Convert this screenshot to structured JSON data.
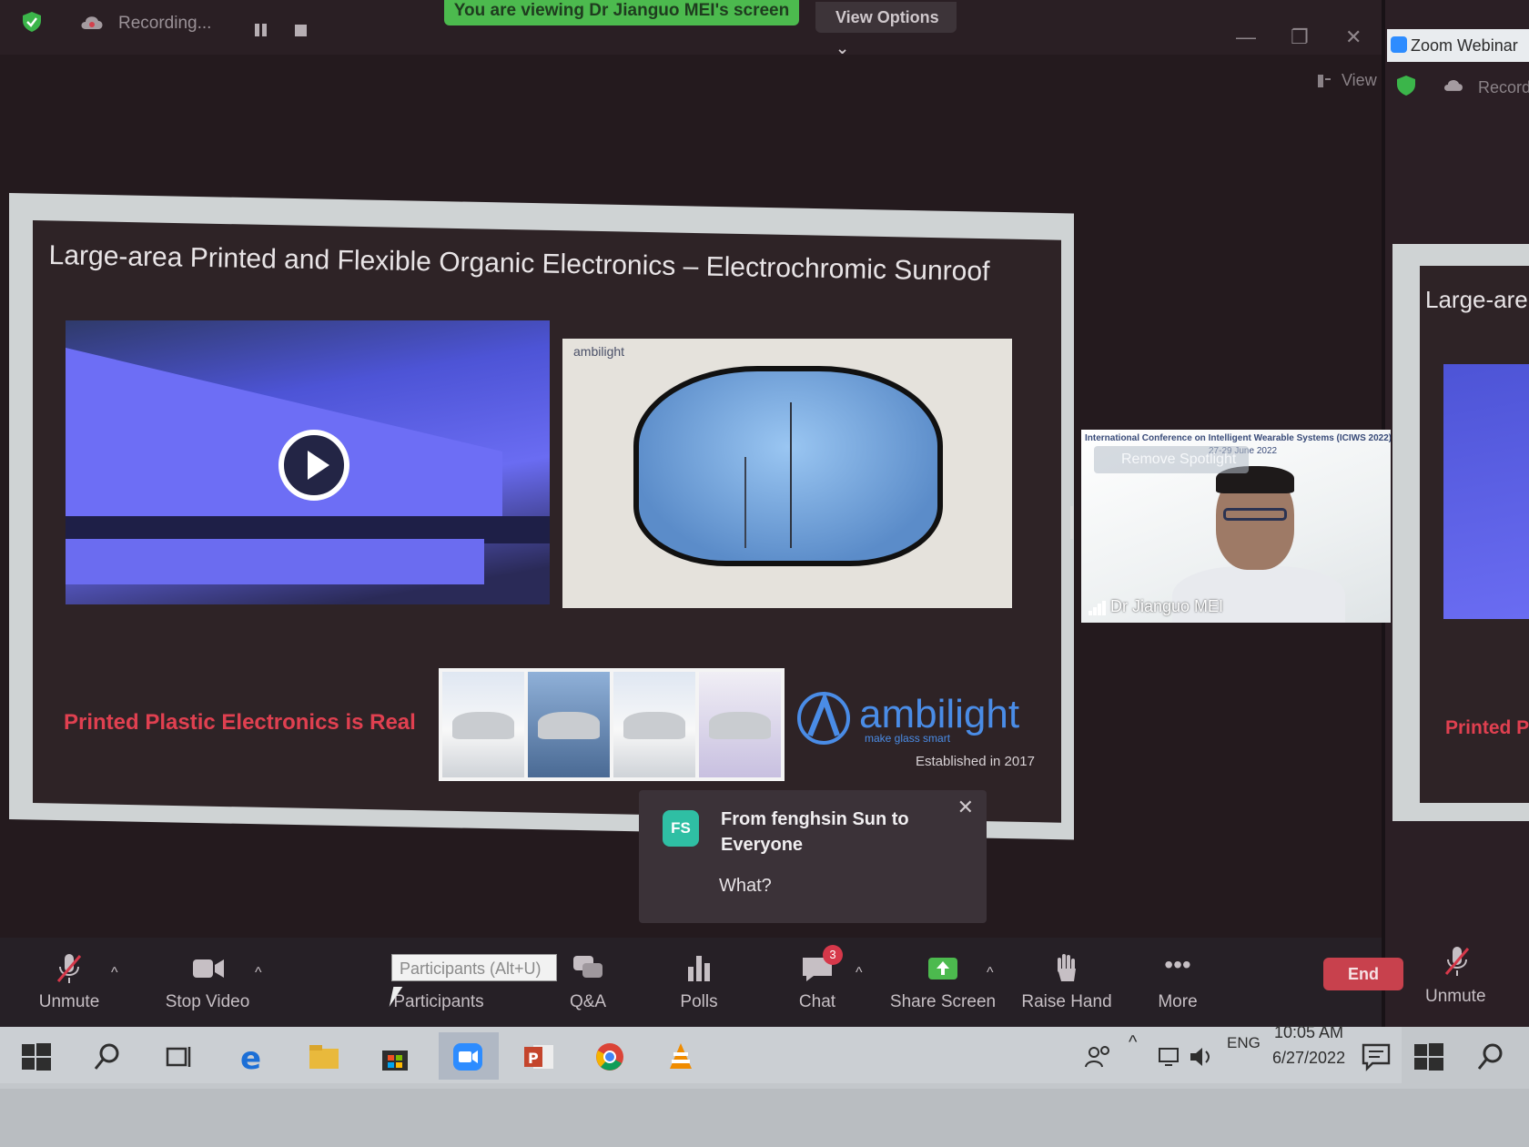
{
  "topbar": {
    "recording_label": "Recording...",
    "viewing_banner": "You are viewing Dr Jianguo MEI's screen",
    "view_options_label": "View Options",
    "view_label": "View"
  },
  "window2": {
    "title": "Zoom Webinar",
    "recording_label": "Recordi",
    "slide_title_partial": "Large-are",
    "red_tag_partial": "Printed P",
    "unmute_label": "Unmute"
  },
  "slide": {
    "title": "Large-area Printed and Flexible Organic Electronics – Electrochromic Sunroof",
    "watermark": "ambilight",
    "red_tagline": "Printed Plastic Electronics is Real",
    "brand_name": "ambilight",
    "brand_tagline": "make glass smart",
    "established": "Established in 2017"
  },
  "speaker": {
    "conference_line": "International Conference on Intelligent Wearable Systems (ICIWS 2022)",
    "conference_dates": "27-29 June 2022",
    "remove_spotlight": "Remove Spotlight",
    "name": "Dr Jianguo MEI"
  },
  "chat_popup": {
    "avatar_initials": "FS",
    "from": "From fenghsin Sun to Everyone",
    "message": "What?"
  },
  "toolbar": {
    "unmute": "Unmute",
    "stop_video": "Stop Video",
    "participants": "Participants",
    "participants_tooltip": "Participants (Alt+U)",
    "qa": "Q&A",
    "polls": "Polls",
    "chat": "Chat",
    "chat_badge": "3",
    "share_screen": "Share Screen",
    "raise_hand": "Raise Hand",
    "more": "More",
    "end": "End"
  },
  "taskbar": {
    "language": "ENG",
    "time": "10:05 AM",
    "date": "6/27/2022"
  },
  "colors": {
    "accent_green": "#4cba4e",
    "end_red": "#c8414d",
    "brand_blue": "#4a8ce6",
    "tagline_red": "#e04050"
  }
}
